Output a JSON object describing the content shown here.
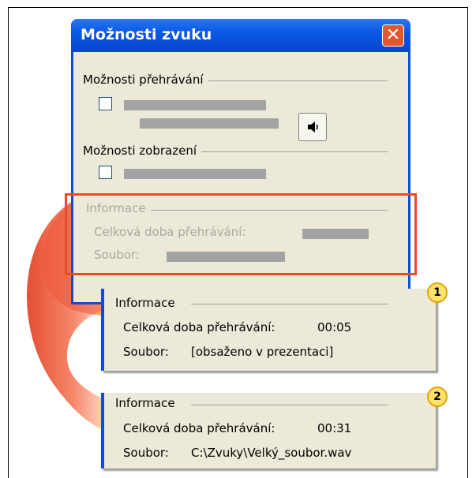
{
  "dialog": {
    "title": "Možnosti zvuku",
    "playback_group": "Možnosti přehrávání",
    "display_group": "Možnosti zobrazení",
    "info_group": "Informace",
    "total_time_label": "Celková doba přehrávání:",
    "file_label": "Soubor:"
  },
  "popup1": {
    "badge": "1",
    "group": "Informace",
    "total_time_label": "Celková doba přehrávání:",
    "total_time_value": "00:05",
    "file_label": "Soubor:",
    "file_value": "[obsaženo v prezentaci]"
  },
  "popup2": {
    "badge": "2",
    "group": "Informace",
    "total_time_label": "Celková doba přehrávání:",
    "total_time_value": "00:31",
    "file_label": "Soubor:",
    "file_value": "C:\\Zvuky\\Velký_soubor.wav"
  },
  "colors": {
    "accent": "#0a4dd6",
    "highlight": "#f04a1c",
    "arrow": "#ee5a3c",
    "badge": "#ffe36a"
  },
  "icons": [
    "close-icon",
    "speaker-icon",
    "curved-arrow"
  ]
}
